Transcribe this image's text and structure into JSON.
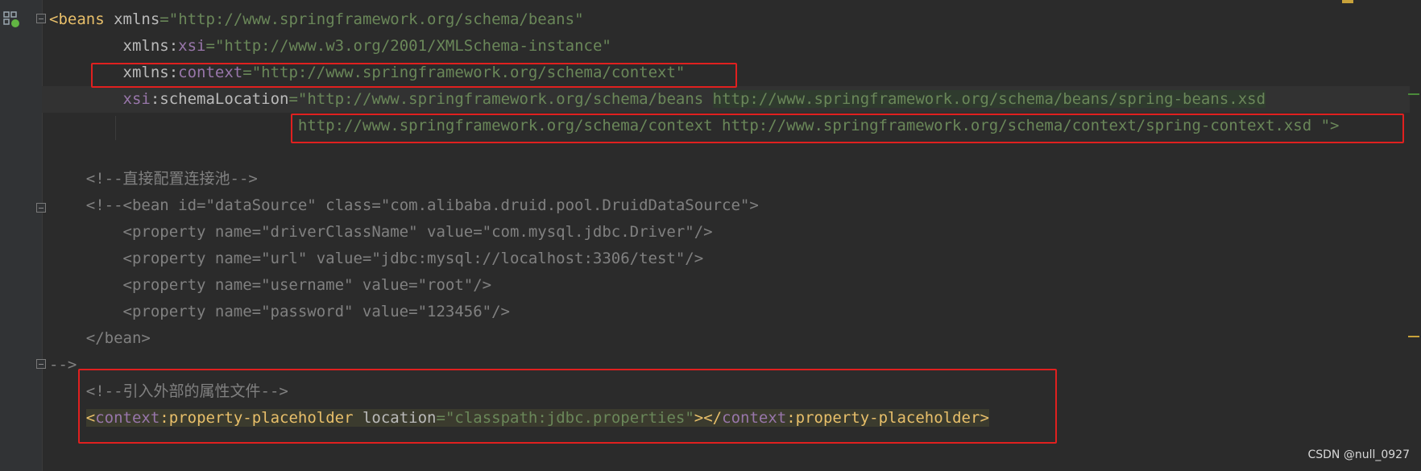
{
  "editor": {
    "lines": {
      "l1": {
        "lt": "<",
        "tag": "beans",
        "attr": " xmlns",
        "eq": "=",
        "val": "\"http://www.springframework.org/schema/beans\""
      },
      "l2": {
        "pre": "        ",
        "attr1": "xmlns",
        "colon": ":",
        "ns": "xsi",
        "eq": "=",
        "val": "\"http://www.w3.org/2001/XMLSchema-instance\""
      },
      "l3": {
        "pre": "        ",
        "attr1": "xmlns",
        "colon": ":",
        "ns": "context",
        "eq": "=",
        "val": "\"http://www.springframework.org/schema/context\""
      },
      "l4": {
        "pre": "        ",
        "ns": "xsi",
        "colon": ":",
        "attr": "schemaLocation",
        "eq": "=",
        "val1": "\"http://www.springframework.org/schema/beans ",
        "val2": "http://www.springframework.org/schema/beans/spring-beans.xsd"
      },
      "l5": {
        "pre": "                           ",
        "val": "http://www.springframework.org/schema/context http://www.springframework.org/schema/context/spring-context.xsd \">"
      },
      "l6": {
        "pre": "    ",
        "text": "<!--直接配置连接池-->"
      },
      "l7": {
        "pre": "    ",
        "text": "<!--<bean id=\"dataSource\" class=\"com.alibaba.druid.pool.DruidDataSource\">"
      },
      "l8": {
        "pre": "        ",
        "text": "<property name=\"driverClassName\" value=\"com.mysql.jdbc.Driver\"/>"
      },
      "l9": {
        "pre": "        ",
        "text": "<property name=\"url\" value=\"jdbc:mysql://localhost:3306/test\"/>"
      },
      "l10": {
        "pre": "        ",
        "text": "<property name=\"username\" value=\"root\"/>"
      },
      "l11": {
        "pre": "        ",
        "text": "<property name=\"password\" value=\"123456\"/>"
      },
      "l12": {
        "pre": "    ",
        "text": "</bean>"
      },
      "l13": {
        "text": "-->"
      },
      "l14": {
        "pre": "    ",
        "text": "<!--引入外部的属性文件-->"
      },
      "l15": {
        "pre": "    ",
        "lt": "<",
        "ns1": "context",
        "c1": ":",
        "tag1": "property-placeholder",
        "attr": " location",
        "eq": "=",
        "val": "\"classpath:jdbc.properties\"",
        "close": "></",
        "ns2": "context",
        "c2": ":",
        "tag2": "property-placeholder",
        "gt": ">"
      }
    }
  },
  "watermark": "CSDN @null_0927",
  "colors": {
    "background": "#2b2b2b",
    "tag": "#e8bf6a",
    "namespace": "#9876aa",
    "string": "#6a8759",
    "comment": "#808080",
    "highlight_box": "#e0201f"
  }
}
